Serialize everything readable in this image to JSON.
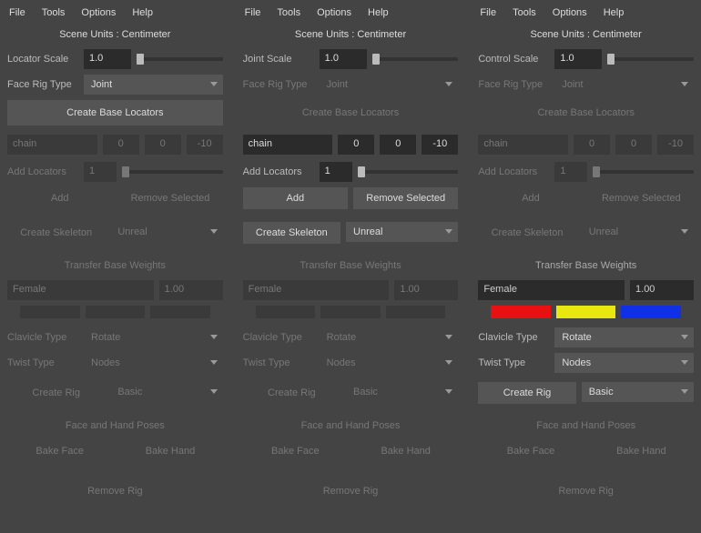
{
  "menu": {
    "file": "File",
    "tools": "Tools",
    "options": "Options",
    "help": "Help"
  },
  "sceneUnits": "Scene Units :  Centimeter",
  "panels": [
    {
      "scaleLabel": "Locator Scale",
      "scaleValue": "1.0",
      "active": "locators"
    },
    {
      "scaleLabel": "Joint Scale",
      "scaleValue": "1.0",
      "active": "skeleton"
    },
    {
      "scaleLabel": "Control Scale",
      "scaleValue": "1.0",
      "active": "rig"
    }
  ],
  "faceRig": {
    "label": "Face Rig Type",
    "value": "Joint"
  },
  "createBase": "Create Base Locators",
  "chain": {
    "name": "chain",
    "a": "0",
    "b": "0",
    "c": "-10"
  },
  "addLoc": {
    "label": "Add Locators",
    "value": "1"
  },
  "buttons": {
    "add": "Add",
    "remove": "Remove Selected",
    "createSkel": "Create Skeleton",
    "createRig": "Create Rig",
    "bakeFace": "Bake Face",
    "bakeHand": "Bake Hand",
    "removeRig": "Remove Rig"
  },
  "skelEngine": "Unreal",
  "weights": {
    "header": "Transfer Base Weights",
    "gender": "Female",
    "value": "1.00"
  },
  "colors": {
    "red": "#e81010",
    "yellow": "#e8e810",
    "blue": "#1030e8"
  },
  "clavicle": {
    "label": "Clavicle Type",
    "value": "Rotate"
  },
  "twist": {
    "label": "Twist Type",
    "value": "Nodes"
  },
  "rigMode": "Basic",
  "poses": "Face and Hand Poses"
}
